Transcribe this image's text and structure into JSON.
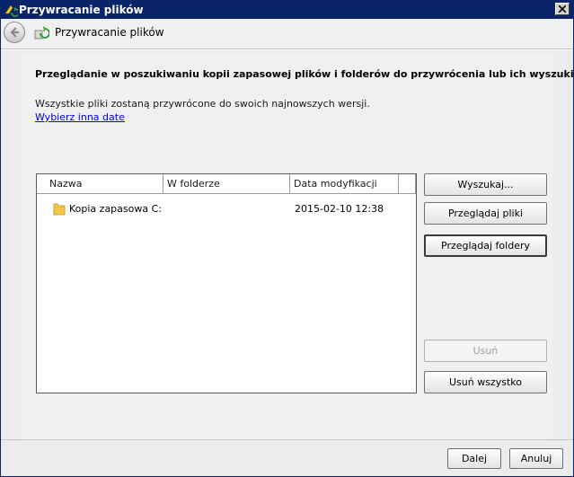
{
  "window": {
    "title": "Przywracanie plików"
  },
  "nav": {
    "title": "Przywracanie plików"
  },
  "main": {
    "heading": "Przeglądanie w poszukiwaniu kopii zapasowej plików i folderów do przywrócenia lub ich wyszukiwanie",
    "info": "Wszystkie pliki zostaną przywrócone do swoich najnowszych wersji.",
    "link": "Wybierz inna date"
  },
  "list": {
    "columns": {
      "name": "Nazwa",
      "folder": "W folderze",
      "date": "Data modyfikacji"
    },
    "rows": [
      {
        "name": "Kopia zapasowa C:",
        "folder": "",
        "date": "2015-02-10 12:38"
      }
    ]
  },
  "buttons": {
    "search": "Wyszukaj...",
    "browse_files": "Przeglądaj pliki",
    "browse_folders": "Przeglądaj foldery",
    "remove": "Usuń",
    "remove_all": "Usuń wszystko"
  },
  "footer": {
    "next": "Dalej",
    "cancel": "Anuluj"
  },
  "colors": {
    "titlebar": "#0a246a",
    "link": "#0000ee",
    "disabled_text": "#a0a0a0"
  }
}
